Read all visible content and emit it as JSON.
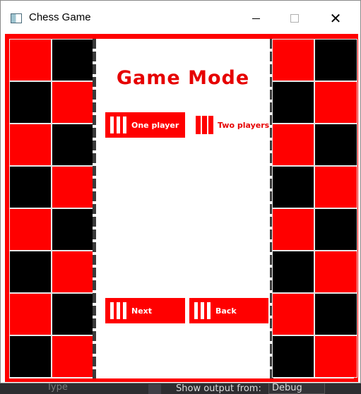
{
  "window": {
    "title": "Chess Game"
  },
  "game_mode": {
    "heading": "Game Mode",
    "buttons": {
      "one_player": "One player",
      "two_players": "Two players",
      "next": "Next",
      "back": "Back"
    }
  },
  "background": {
    "type_label": "Type",
    "output_label": "Show output from:",
    "output_value": "Debug"
  },
  "colors": {
    "accent": "#ff0000",
    "dark_square": "#000000",
    "light_square": "#ff0000"
  },
  "icons": {
    "app": "app-window-icon",
    "minimize": "minimize-icon",
    "maximize": "maximize-icon",
    "close": "close-icon"
  }
}
